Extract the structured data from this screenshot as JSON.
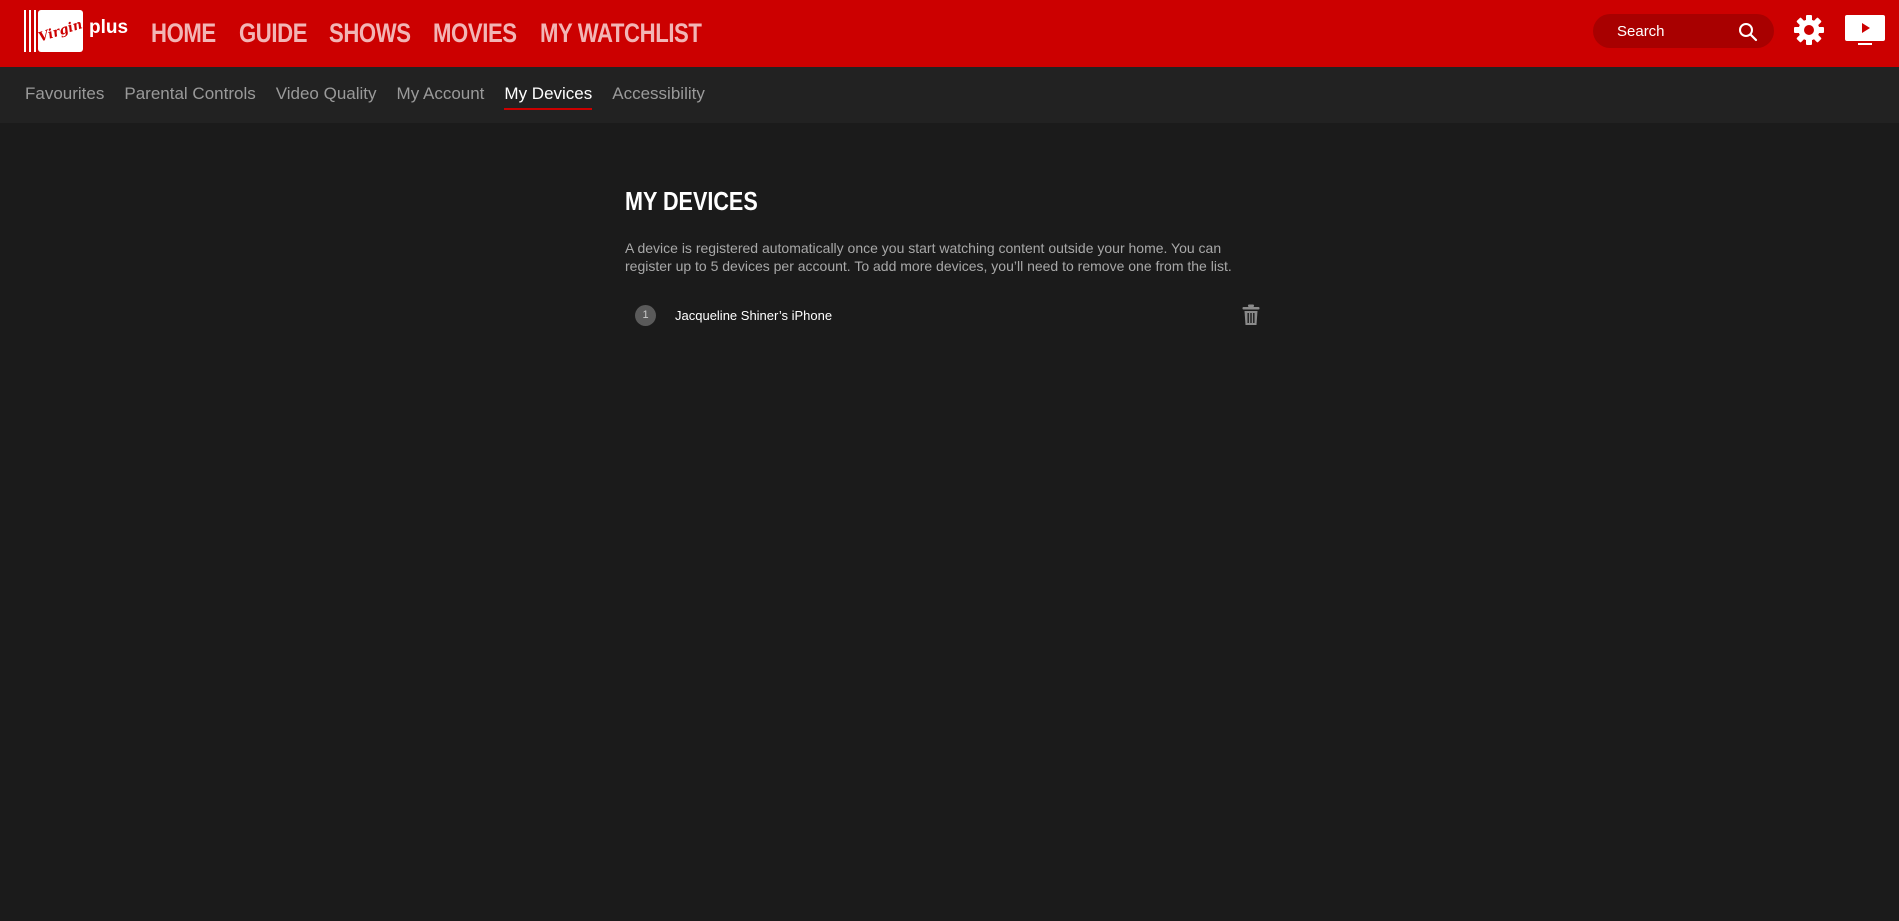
{
  "brand": {
    "logo_text": "Virgin",
    "suffix": "plus",
    "color": "#cc0000"
  },
  "main_nav": [
    {
      "label": "HOME"
    },
    {
      "label": "GUIDE"
    },
    {
      "label": "SHOWS"
    },
    {
      "label": "MOVIES"
    },
    {
      "label": "MY WATCHLIST"
    }
  ],
  "search": {
    "placeholder": "Search",
    "icon": "search-icon"
  },
  "header_icons": [
    "gear-icon",
    "tv-icon"
  ],
  "sub_nav": [
    {
      "label": "Favourites",
      "active": false
    },
    {
      "label": "Parental Controls",
      "active": false
    },
    {
      "label": "Video Quality",
      "active": false
    },
    {
      "label": "My Account",
      "active": false
    },
    {
      "label": "My Devices",
      "active": true
    },
    {
      "label": "Accessibility",
      "active": false
    }
  ],
  "page": {
    "title": "MY DEVICES",
    "description": "A device is registered automatically once you start watching content outside your home. You can register up to 5 devices per account. To add more devices, you’ll need to remove one from the list."
  },
  "devices": [
    {
      "index": "1",
      "name": "Jacqueline Shiner’s iPhone",
      "action_icon": "trash-icon"
    }
  ],
  "colors": {
    "header_bg": "#cc0000",
    "subnav_bg": "#222222",
    "page_bg": "#1b1b1b",
    "active_underline": "#cc0000"
  }
}
